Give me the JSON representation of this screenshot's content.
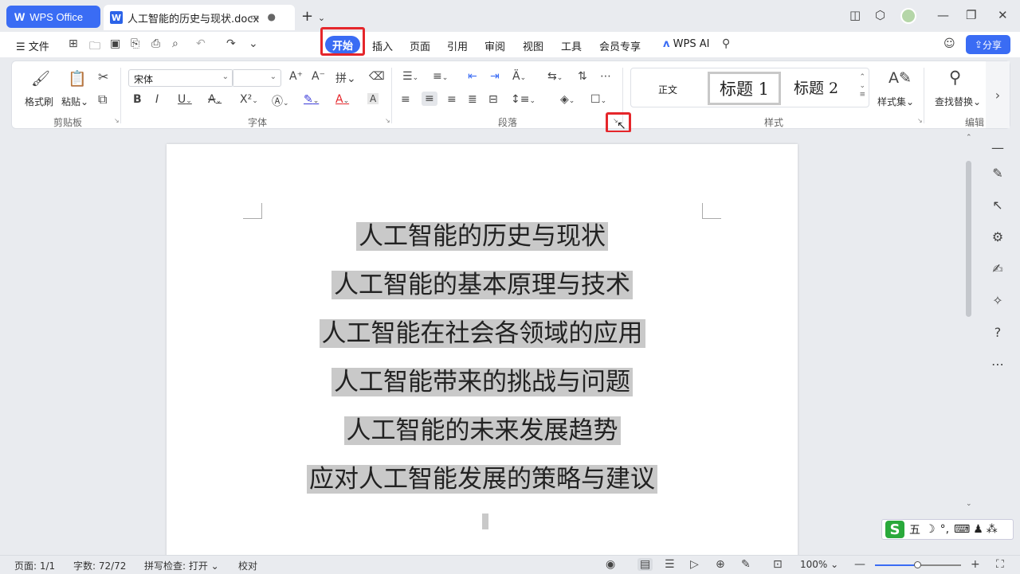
{
  "app": {
    "name": "WPS Office",
    "doc_tab": "人工智能的历史与现状.docx"
  },
  "menu": {
    "file": "文件",
    "tabs": [
      "开始",
      "插入",
      "页面",
      "引用",
      "审阅",
      "视图",
      "工具",
      "会员专享"
    ],
    "active_tab": "开始",
    "wps_ai": "WPS AI",
    "share": "分享"
  },
  "ribbon": {
    "clipboard": {
      "label": "剪贴板",
      "format_painter": "格式刷",
      "paste": "粘贴"
    },
    "font": {
      "label": "字体",
      "font_name": "宋体",
      "font_size": ""
    },
    "paragraph": {
      "label": "段落"
    },
    "styles": {
      "label": "样式",
      "normal": "正文",
      "heading1": "标题 1",
      "heading2": "标题 2",
      "style_set": "样式集"
    },
    "edit": {
      "label": "编辑",
      "find_replace": "查找替换"
    }
  },
  "document": {
    "lines": [
      "人工智能的历史与现状",
      "人工智能的基本原理与技术",
      "人工智能在社会各领域的应用",
      "人工智能带来的挑战与问题",
      "人工智能的未来发展趋势",
      "应对人工智能发展的策略与建议"
    ]
  },
  "ime": {
    "mode": "五"
  },
  "status": {
    "page": "页面: 1/1",
    "words": "字数: 72/72",
    "spellcheck": "拼写检查: 打开",
    "proofread": "校对",
    "zoom": "100%",
    "zoom_fraction": 0.5
  },
  "colors": {
    "accent": "#3a6cf4",
    "highlight": "#e5262b",
    "selection": "#c9c9c9"
  }
}
